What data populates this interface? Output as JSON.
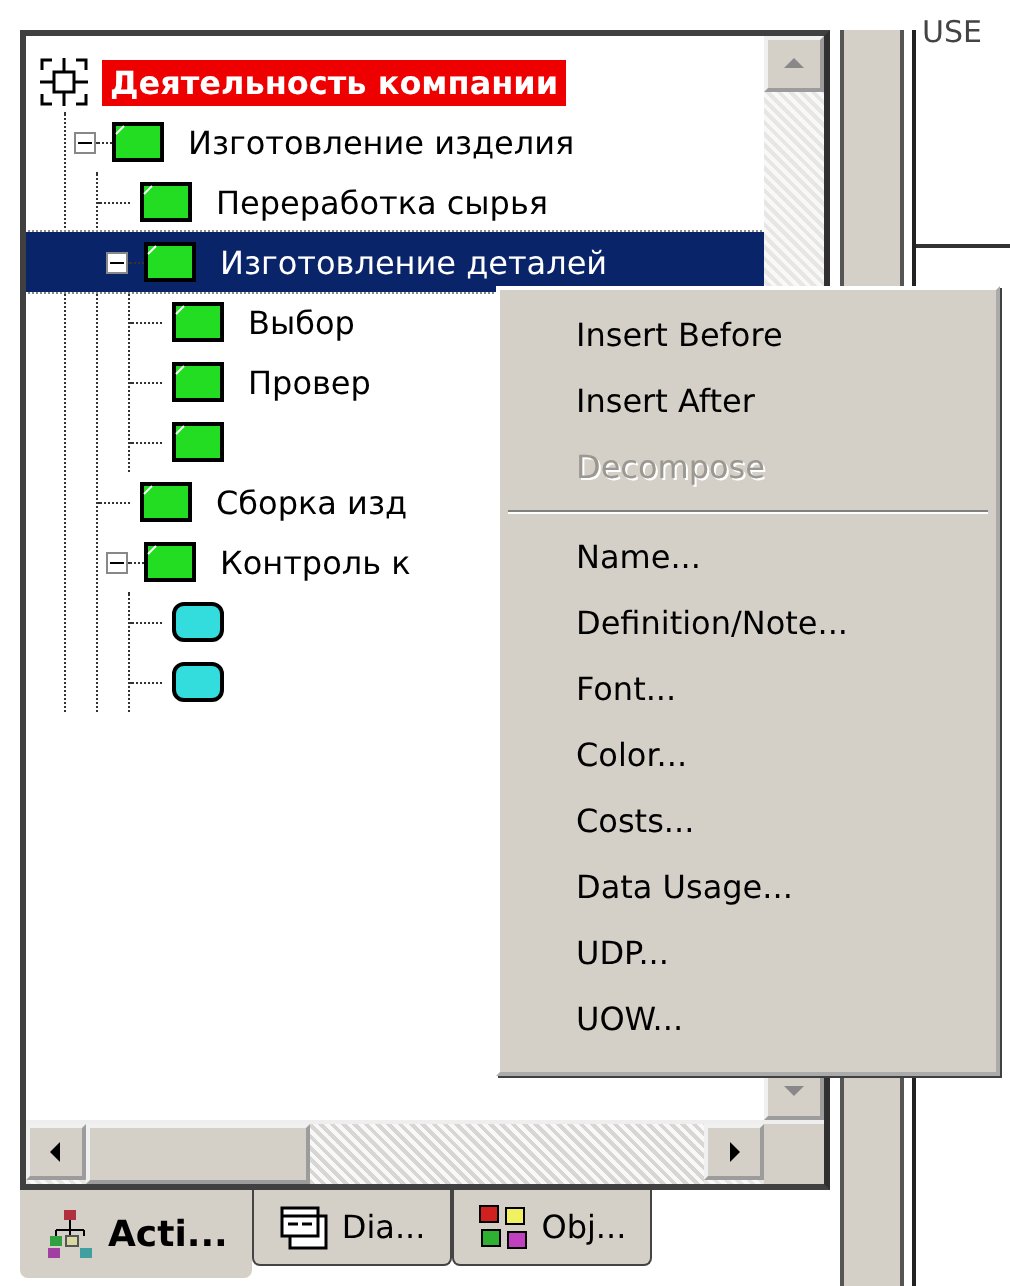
{
  "tree": {
    "root": {
      "label": "Деятельность компании",
      "kind": "root",
      "selected": false,
      "children": [
        {
          "label": "Изготовление изделия",
          "kind": "activity",
          "selected": false,
          "expanded": true,
          "children": [
            {
              "label": "Переработка  сырья",
              "kind": "activity",
              "selected": false
            },
            {
              "label": "Изготовление  деталей",
              "kind": "activity",
              "selected": true,
              "expanded": true,
              "children": [
                {
                  "label": "Выбор",
                  "kind": "activity",
                  "selected": false
                },
                {
                  "label": "Провер",
                  "kind": "activity",
                  "selected": false
                },
                {
                  "kind": "activity",
                  "selected": false
                }
              ]
            },
            {
              "label": "Сборка изд",
              "kind": "activity",
              "selected": false
            },
            {
              "label": "Контроль к",
              "kind": "activity",
              "selected": false,
              "expanded": true,
              "children": [
                {
                  "kind": "step",
                  "selected": false
                },
                {
                  "kind": "step",
                  "selected": false
                }
              ]
            }
          ]
        }
      ]
    }
  },
  "tabs": [
    {
      "label": "Acti...",
      "kind": "activities",
      "selected": true
    },
    {
      "label": "Dia...",
      "kind": "diagrams",
      "selected": false
    },
    {
      "label": "Obj...",
      "kind": "objects",
      "selected": false
    }
  ],
  "side_panel": {
    "text": "USE"
  },
  "context_menu": {
    "items": [
      {
        "kind": "command",
        "label": "Insert Before",
        "disabled": false
      },
      {
        "kind": "command",
        "label": "Insert After",
        "disabled": false
      },
      {
        "kind": "command",
        "label": "Decompose",
        "disabled": true
      },
      {
        "kind": "separator"
      },
      {
        "kind": "command",
        "label": "Name...",
        "disabled": false
      },
      {
        "kind": "command",
        "label": "Definition/Note...",
        "disabled": false
      },
      {
        "kind": "command",
        "label": "Font...",
        "disabled": false
      },
      {
        "kind": "command",
        "label": "Color...",
        "disabled": false
      },
      {
        "kind": "command",
        "label": "Costs...",
        "disabled": false
      },
      {
        "kind": "command",
        "label": "Data Usage...",
        "disabled": false
      },
      {
        "kind": "command",
        "label": "UDP...",
        "disabled": false
      },
      {
        "kind": "command",
        "label": "UOW...",
        "disabled": false
      }
    ]
  }
}
